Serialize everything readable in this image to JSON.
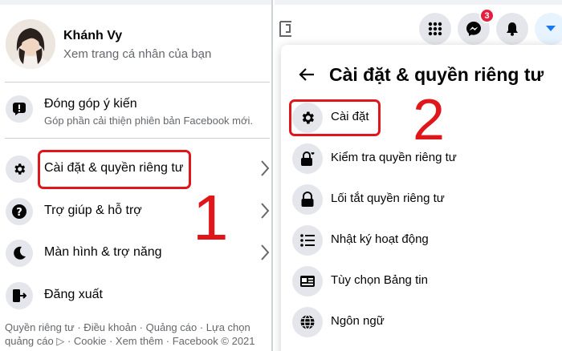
{
  "left": {
    "profile": {
      "name": "Khánh Vy",
      "subtitle": "Xem trang cá nhân của bạn"
    },
    "feedback": {
      "label": "Đóng góp ý kiến",
      "sub": "Góp phần cải thiện phiên bản Facebook mới."
    },
    "menu": [
      {
        "label": "Cài đặt & quyền riêng tư",
        "icon": "gear-icon"
      },
      {
        "label": "Trợ giúp & hỗ trợ",
        "icon": "help-icon"
      },
      {
        "label": "Màn hình & trợ năng",
        "icon": "moon-icon"
      },
      {
        "label": "Đăng xuất",
        "icon": "logout-icon"
      }
    ],
    "footer": {
      "line1": "Quyền riêng tư · Điều khoản · Quảng cáo · Lựa chọn",
      "line2": "quảng cáo ▷ · Cookie · Xem thêm · Facebook © 2021"
    },
    "step_number": "1"
  },
  "right": {
    "notification_count": "3",
    "title": "Cài đặt & quyền riêng tư",
    "items": [
      {
        "label": "Cài đặt",
        "icon": "gear-icon"
      },
      {
        "label": "Kiểm tra quyền riêng tư",
        "icon": "lock-heart-icon"
      },
      {
        "label": "Lối tắt quyền riêng tư",
        "icon": "lock-icon"
      },
      {
        "label": "Nhật ký hoạt động",
        "icon": "list-icon"
      },
      {
        "label": "Tùy chọn Bảng tin",
        "icon": "news-feed-icon"
      },
      {
        "label": "Ngôn ngữ",
        "icon": "globe-icon"
      }
    ],
    "step_number": "2"
  },
  "colors": {
    "highlight": "#e0161b",
    "icon_bg": "#e4e6eb",
    "secondary_text": "#65676b",
    "accent_blue": "#1877f2",
    "badge_red": "#e41e3f"
  }
}
